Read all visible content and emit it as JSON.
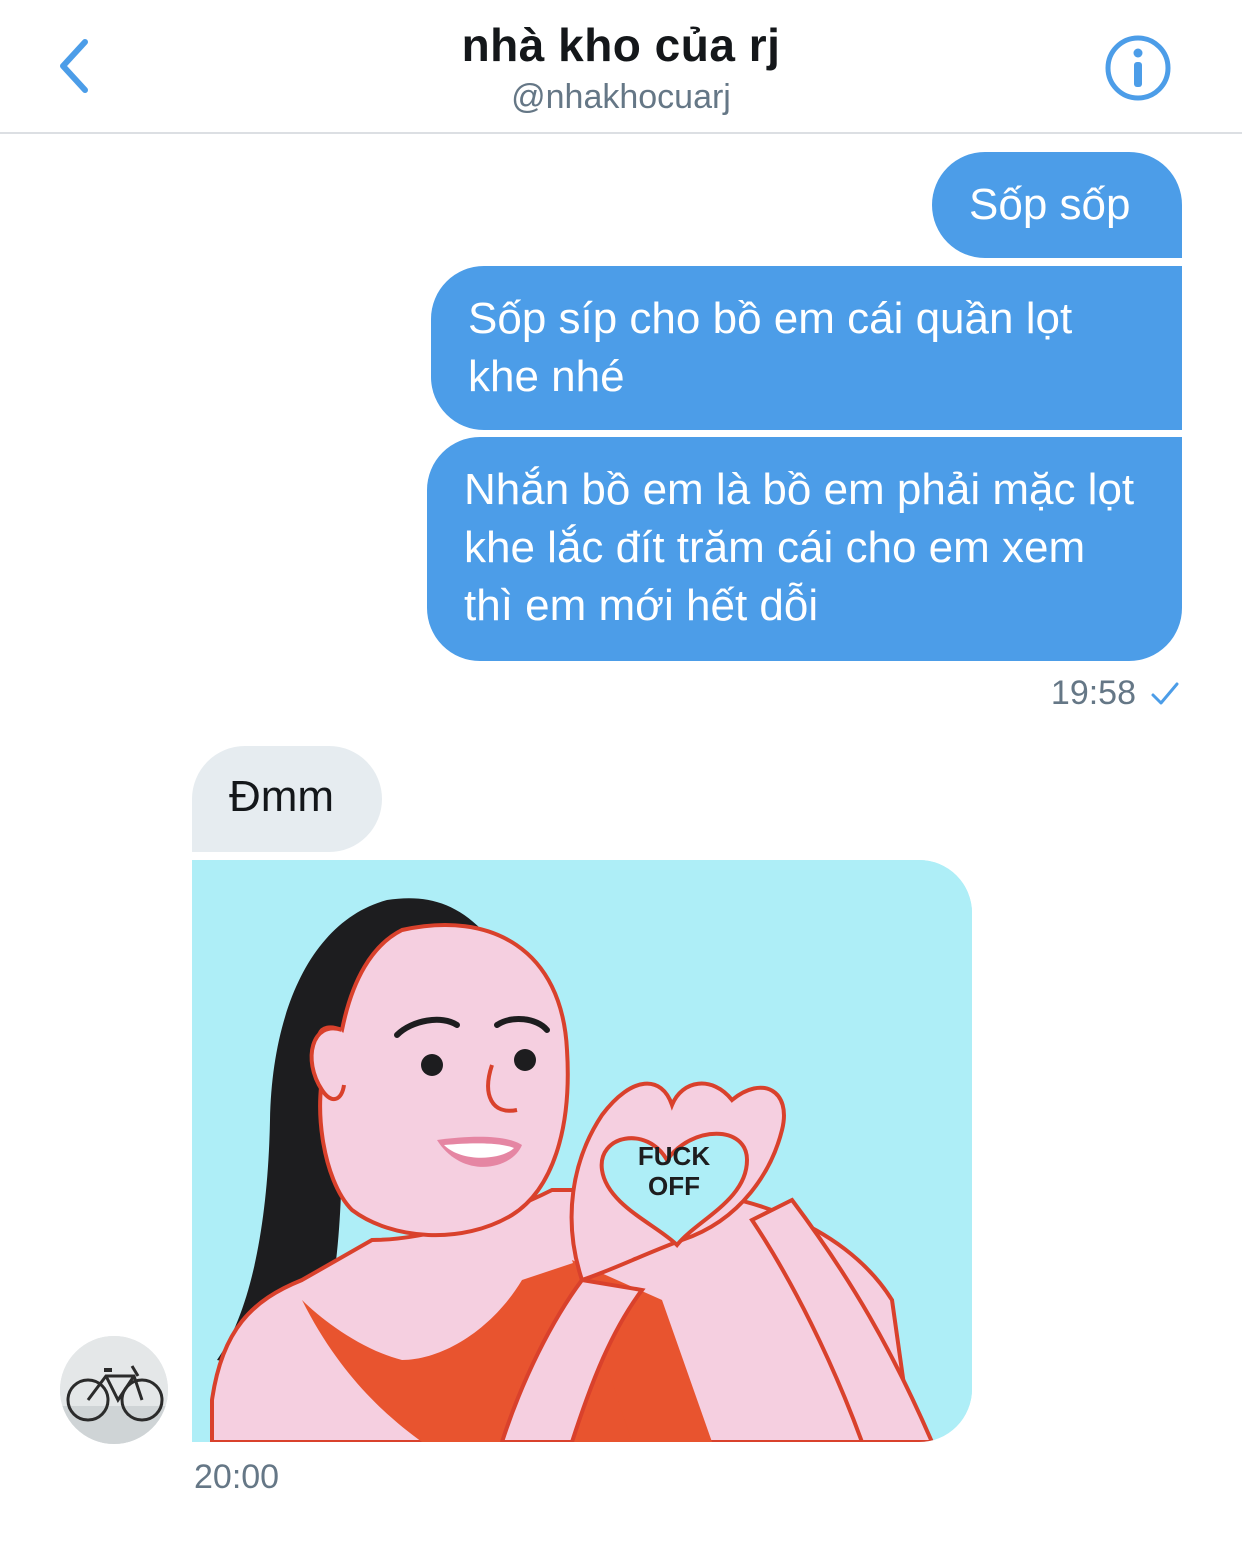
{
  "header": {
    "title": "nhà kho của rj",
    "handle": "@nhakhocuarj",
    "back_icon": "chevron-left-icon",
    "info_icon": "info-icon",
    "accent": "#4c9de8"
  },
  "messages": {
    "sent": [
      {
        "text": "Sốp sốp"
      },
      {
        "text": "Sốp síp cho bồ em cái quần lọt khe nhé"
      },
      {
        "text": "Nhắn bồ em là bồ em phải mặc lọt khe lắc đít trăm cái cho em xem thì em mới hết dỗi"
      }
    ],
    "sent_time": "19:58",
    "sent_status_icon": "checkmark-icon",
    "received": {
      "text": "Đmm",
      "image": {
        "description_icon": "heart-hands-illustration",
        "caption_text": "FUCK OFF"
      },
      "time": "20:00"
    }
  },
  "colors": {
    "sent_bubble": "#4c9de8",
    "received_bubble": "#e6ecf0",
    "muted_text": "#657786"
  }
}
